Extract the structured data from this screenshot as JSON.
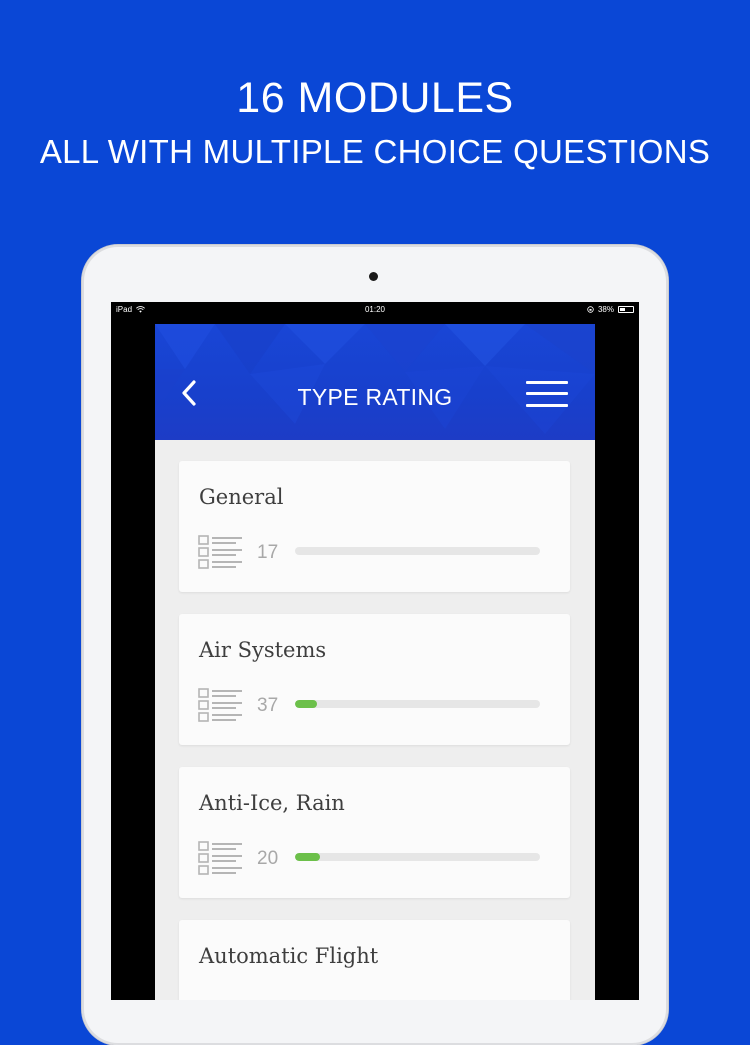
{
  "promo": {
    "headline": "16 MODULES",
    "subline": "ALL WITH MULTIPLE CHOICE QUESTIONS"
  },
  "status_bar": {
    "carrier": "iPad",
    "time": "01:20",
    "battery": "38%",
    "battery_level": 0.38
  },
  "header": {
    "title": "TYPE RATING",
    "back_icon": "chevron-left-icon",
    "menu_icon": "hamburger-menu-icon",
    "color": "#1946d6"
  },
  "modules": [
    {
      "title": "General",
      "count": "17",
      "progress": 0.0
    },
    {
      "title": "Air Systems",
      "count": "37",
      "progress": 0.09
    },
    {
      "title": "Anti-Ice, Rain",
      "count": "20",
      "progress": 0.1
    },
    {
      "title": "Automatic Flight",
      "count": "",
      "progress": 0.0
    }
  ],
  "colors": {
    "background": "#0a47d6",
    "progress_fill": "#6cc04a",
    "progress_track": "#e6e6e6"
  }
}
